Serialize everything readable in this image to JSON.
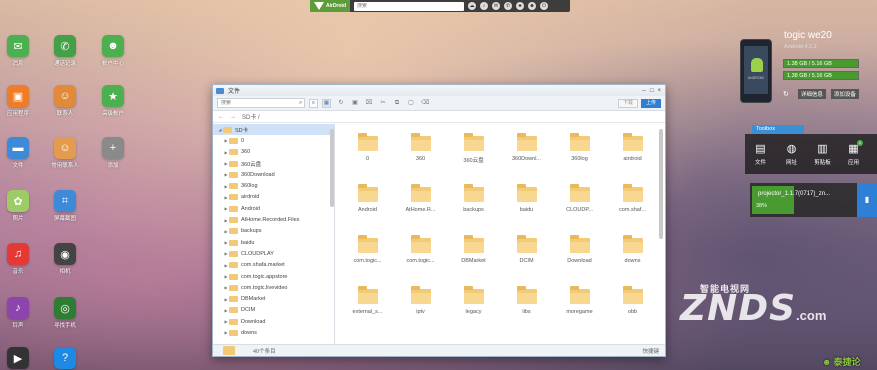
{
  "topbar": {
    "brand": "AirDroid",
    "search_placeholder": "搜索",
    "icons": [
      "cloud-icon",
      "ringtone-icon",
      "mail-icon",
      "phone-icon",
      "bell-icon",
      "user-icon",
      "power-icon"
    ]
  },
  "dock": [
    {
      "label": "消息",
      "icon": "message-icon",
      "color": "#4caf50",
      "glyph": "✉"
    },
    {
      "label": "通话记录",
      "icon": "phone-call-icon",
      "color": "#43a047",
      "glyph": "✆"
    },
    {
      "label": "帐户中心",
      "icon": "account-icon",
      "color": "#4caf50",
      "glyph": "☻"
    },
    {
      "label": "应用程序",
      "icon": "apps-icon",
      "color": "#ef7d28",
      "glyph": "▣"
    },
    {
      "label": "联系人",
      "icon": "contacts-icon",
      "color": "#e08a3a",
      "glyph": "☺"
    },
    {
      "label": "高级帐户",
      "icon": "premium-icon",
      "color": "#4caf50",
      "glyph": "★"
    },
    {
      "label": "文件",
      "icon": "folder-icon",
      "color": "#3d8ad8",
      "glyph": "▬"
    },
    {
      "label": "常用联系人",
      "icon": "favorite-contacts-icon",
      "color": "#e39c4f",
      "glyph": "☺"
    },
    {
      "label": "添加",
      "icon": "add-icon",
      "color": "#8a8a8a",
      "glyph": "+"
    },
    {
      "label": "照片",
      "icon": "photos-icon",
      "color": "#9ccc65",
      "glyph": "✿"
    },
    {
      "label": "屏幕截图",
      "icon": "screenshot-icon",
      "color": "#3d8ad8",
      "glyph": "⌗"
    },
    {
      "label": "音乐",
      "icon": "music-icon",
      "color": "#e53935",
      "glyph": "♫"
    },
    {
      "label": "相机",
      "icon": "camera-icon",
      "color": "#444444",
      "glyph": "◉"
    },
    {
      "label": "铃声",
      "icon": "ringtone-icon",
      "color": "#8e44ad",
      "glyph": "♪"
    },
    {
      "label": "寻找手机",
      "icon": "find-phone-icon",
      "color": "#2e7d32",
      "glyph": "◎"
    },
    {
      "label": "",
      "icon": "video-icon",
      "color": "#333333",
      "glyph": "▶"
    },
    {
      "label": "",
      "icon": "help-icon",
      "color": "#1e88e5",
      "glyph": "?"
    }
  ],
  "file_window": {
    "title": "文件",
    "search_placeholder": "搜索",
    "download_label": "下载",
    "upload_label": "上传",
    "path": "SD卡 /",
    "tree": [
      {
        "label": "SD卡",
        "root": true
      },
      {
        "label": "0"
      },
      {
        "label": "360"
      },
      {
        "label": "360云盘"
      },
      {
        "label": "360Download"
      },
      {
        "label": "360log"
      },
      {
        "label": "airdroid"
      },
      {
        "label": "Android"
      },
      {
        "label": "AtHome.Recorded.Files"
      },
      {
        "label": "backups"
      },
      {
        "label": "baidu"
      },
      {
        "label": "CLOUDPLAY"
      },
      {
        "label": "com.shafa.market"
      },
      {
        "label": "com.togic.appstore"
      },
      {
        "label": "com.togic.livevideo"
      },
      {
        "label": "DBMarket"
      },
      {
        "label": "DCIM"
      },
      {
        "label": "Download"
      },
      {
        "label": "downs"
      }
    ],
    "folders": [
      "0",
      "360",
      "360云盘",
      "360Downl...",
      "360log",
      "airdroid",
      "Android",
      "AtHome.R...",
      "backups",
      "baidu",
      "CLOUDP...",
      "com.shaf...",
      "com.togic...",
      "com.togic...",
      "DBMarket",
      "DCIM",
      "Download",
      "downs",
      "external_s...",
      "iptv",
      "legacy",
      "libs",
      "moregame",
      "obb"
    ],
    "status_count": "40个条目",
    "status_right": "快捷键"
  },
  "device": {
    "name": "togic we20",
    "version": "Android 4.2.2",
    "phone_text": "ANDROID",
    "storage": [
      {
        "label": "1.38 GB / 5.16 GB",
        "fraction": 0.27
      },
      {
        "label": "1.38 GB / 5.16 GB",
        "fraction": 0.27
      }
    ],
    "details_label": "详细信息",
    "add_device_label": "添加设备"
  },
  "toolbox": {
    "tab_label": "Toolbox",
    "tools": [
      {
        "label": "文件",
        "icon": "file-icon",
        "glyph": "▤"
      },
      {
        "label": "网址",
        "icon": "globe-icon",
        "glyph": "◍"
      },
      {
        "label": "剪贴板",
        "icon": "clipboard-icon",
        "glyph": "▥"
      },
      {
        "label": "应用",
        "icon": "app-icon",
        "glyph": "▦",
        "badge": "1"
      }
    ]
  },
  "transfer": {
    "filename": "projector_1.1.7(0717)_zn...",
    "percent": "38%",
    "progress": 0.38
  },
  "watermark": {
    "sub": "智能电视网",
    "main": "ZNDS",
    "dotcom": ".com",
    "corner": "泰捷论"
  }
}
